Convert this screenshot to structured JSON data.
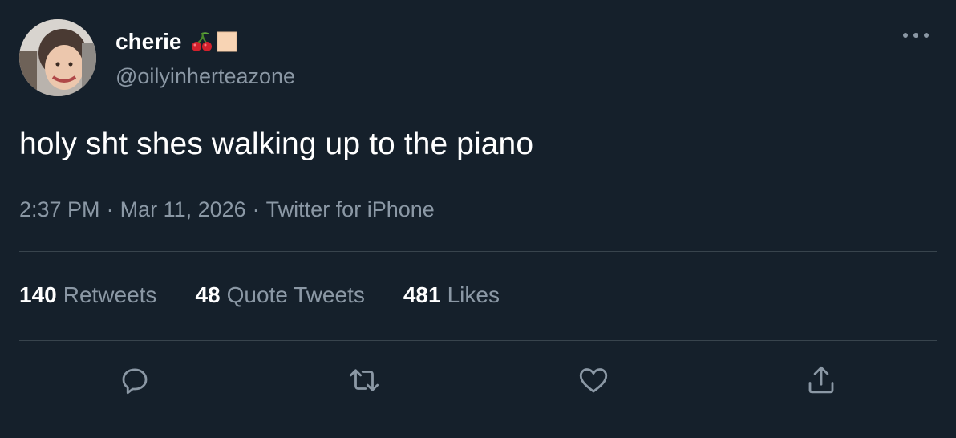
{
  "user": {
    "display_name": "cherie",
    "name_emojis": [
      "cherry-emoji",
      "beige-square-emoji"
    ],
    "handle": "@oilyinherteazone"
  },
  "tweet": {
    "text": "holy sht shes walking up to the piano",
    "time": "2:37 PM",
    "date": "Mar 11, 2026",
    "source": "Twitter for iPhone",
    "separator": "·"
  },
  "stats": {
    "retweets": {
      "count": "140",
      "label": "Retweets"
    },
    "quotes": {
      "count": "48",
      "label": "Quote Tweets"
    },
    "likes": {
      "count": "481",
      "label": "Likes"
    }
  },
  "actions": [
    "reply-icon",
    "retweet-icon",
    "like-icon",
    "share-icon"
  ],
  "colors": {
    "background": "#15202b",
    "primary_text": "#ffffff",
    "secondary_text": "#8b98a5",
    "divider": "#38444d"
  }
}
